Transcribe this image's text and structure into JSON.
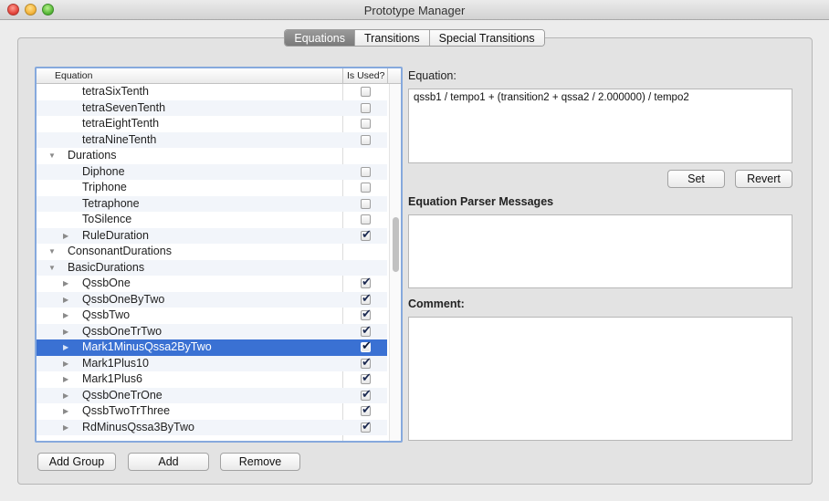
{
  "window": {
    "title": "Prototype Manager"
  },
  "tabs": [
    "Equations",
    "Transitions",
    "Special Transitions"
  ],
  "table": {
    "col_equation": "Equation",
    "col_used": "Is Used?",
    "rows": [
      {
        "label": "tetraSixTenth",
        "level": 2,
        "expander": false,
        "used": false,
        "checkbox": true,
        "selected": false
      },
      {
        "label": "tetraSevenTenth",
        "level": 2,
        "expander": false,
        "used": false,
        "checkbox": true,
        "selected": false
      },
      {
        "label": "tetraEightTenth",
        "level": 2,
        "expander": false,
        "used": false,
        "checkbox": true,
        "selected": false
      },
      {
        "label": "tetraNineTenth",
        "level": 2,
        "expander": false,
        "used": false,
        "checkbox": true,
        "selected": false
      },
      {
        "label": "Durations",
        "level": 1,
        "expander": "open",
        "used": false,
        "checkbox": false,
        "selected": false
      },
      {
        "label": "Diphone",
        "level": 2,
        "expander": false,
        "used": false,
        "checkbox": true,
        "selected": false
      },
      {
        "label": "Triphone",
        "level": 2,
        "expander": false,
        "used": false,
        "checkbox": true,
        "selected": false
      },
      {
        "label": "Tetraphone",
        "level": 2,
        "expander": false,
        "used": false,
        "checkbox": true,
        "selected": false
      },
      {
        "label": "ToSilence",
        "level": 2,
        "expander": false,
        "used": false,
        "checkbox": true,
        "selected": false
      },
      {
        "label": "RuleDuration",
        "level": 2,
        "expander": "closed",
        "used": true,
        "checkbox": true,
        "selected": false
      },
      {
        "label": "ConsonantDurations",
        "level": 1,
        "expander": "open",
        "used": false,
        "checkbox": false,
        "selected": false
      },
      {
        "label": "BasicDurations",
        "level": 1,
        "expander": "open",
        "used": false,
        "checkbox": false,
        "selected": false
      },
      {
        "label": "QssbOne",
        "level": 2,
        "expander": "closed",
        "used": true,
        "checkbox": true,
        "selected": false
      },
      {
        "label": "QssbOneByTwo",
        "level": 2,
        "expander": "closed",
        "used": true,
        "checkbox": true,
        "selected": false
      },
      {
        "label": "QssbTwo",
        "level": 2,
        "expander": "closed",
        "used": true,
        "checkbox": true,
        "selected": false
      },
      {
        "label": "QssbOneTrTwo",
        "level": 2,
        "expander": "closed",
        "used": true,
        "checkbox": true,
        "selected": false
      },
      {
        "label": "Mark1MinusQssa2ByTwo",
        "level": 2,
        "expander": "closed",
        "used": true,
        "checkbox": true,
        "selected": true
      },
      {
        "label": "Mark1Plus10",
        "level": 2,
        "expander": "closed",
        "used": true,
        "checkbox": true,
        "selected": false
      },
      {
        "label": "Mark1Plus6",
        "level": 2,
        "expander": "closed",
        "used": true,
        "checkbox": true,
        "selected": false
      },
      {
        "label": "QssbOneTrOne",
        "level": 2,
        "expander": "closed",
        "used": true,
        "checkbox": true,
        "selected": false
      },
      {
        "label": "QssbTwoTrThree",
        "level": 2,
        "expander": "closed",
        "used": true,
        "checkbox": true,
        "selected": false
      },
      {
        "label": "RdMinusQssa3ByTwo",
        "level": 2,
        "expander": "closed",
        "used": true,
        "checkbox": true,
        "selected": false
      }
    ]
  },
  "buttons": {
    "add_group": "Add Group",
    "add": "Add",
    "remove": "Remove",
    "set": "Set",
    "revert": "Revert"
  },
  "equation": {
    "label": "Equation:",
    "value": "qssb1 / tempo1 + (transition2 + qssa2 / 2.000000) / tempo2"
  },
  "parser": {
    "label": "Equation Parser Messages",
    "value": ""
  },
  "comment": {
    "label": "Comment:",
    "value": ""
  }
}
